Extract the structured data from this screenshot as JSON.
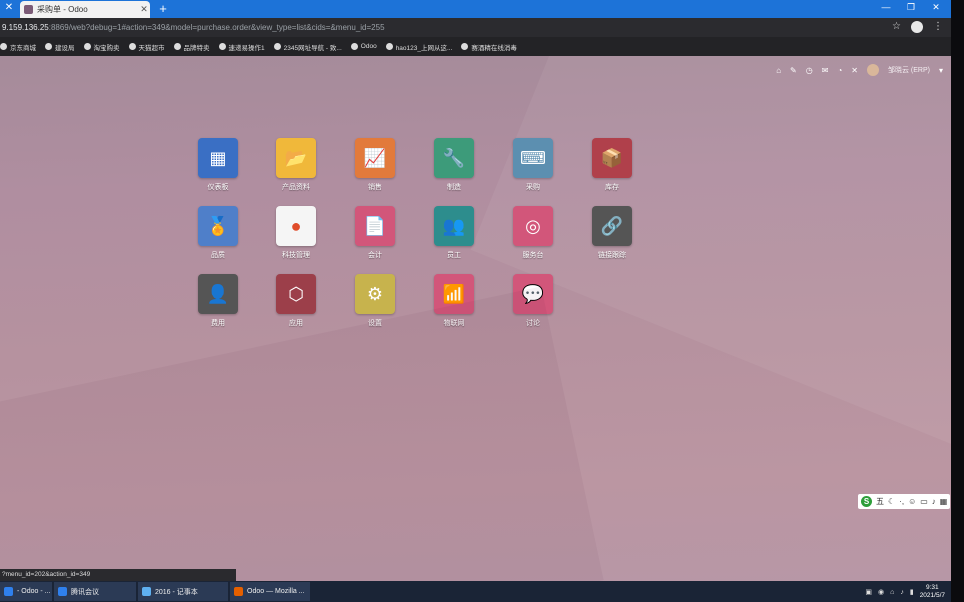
{
  "browser": {
    "tab_title": "采购单 - Odoo",
    "url_host": "9.159.136.25",
    "url_rest": ":8869/web?debug=1#action=349&model=purchase.order&view_type=list&cids=&menu_id=255",
    "bookmarks": [
      "京东商城",
      "建设局",
      "淘宝购卖",
      "天猫超市",
      "品牌特卖",
      "速递易操作1",
      "2345网址导航 - 致...",
      "Odoo",
      "hao123_上网从这...",
      "赛酒精在线消毒"
    ]
  },
  "odoo": {
    "user_name": "邹晓云 (ERP)",
    "apps": [
      {
        "label": "仪表板",
        "color": "#3a6fc4",
        "glyph": "▦"
      },
      {
        "label": "产品资料",
        "color": "#f0b83a",
        "glyph": "📂"
      },
      {
        "label": "销售",
        "color": "#e27a3b",
        "glyph": "📈"
      },
      {
        "label": "制造",
        "color": "#3d9b7a",
        "glyph": "🔧"
      },
      {
        "label": "采购",
        "color": "#5c8fb0",
        "glyph": "⌨"
      },
      {
        "label": "库存",
        "color": "#b0404b",
        "glyph": "📦"
      },
      {
        "label": "品质",
        "color": "#4f7fc9",
        "glyph": "🏅"
      },
      {
        "label": "科技管理",
        "color": "#f5f5f5",
        "glyph": "●"
      },
      {
        "label": "会计",
        "color": "#d2567a",
        "glyph": "📄"
      },
      {
        "label": "员工",
        "color": "#2d8d8d",
        "glyph": "👥"
      },
      {
        "label": "服务台",
        "color": "#d2567a",
        "glyph": "◎"
      },
      {
        "label": "链接跟踪",
        "color": "#555555",
        "glyph": "🔗"
      },
      {
        "label": "费用",
        "color": "#555555",
        "glyph": "👤"
      },
      {
        "label": "应用",
        "color": "#9c3f4a",
        "glyph": "⬡"
      },
      {
        "label": "设置",
        "color": "#c7b34d",
        "glyph": "⚙"
      },
      {
        "label": "物联网",
        "color": "#d2567a",
        "glyph": "📶"
      },
      {
        "label": "讨论",
        "color": "#d2567a",
        "glyph": "💬"
      }
    ]
  },
  "status_link": "?menu_id=202&action_id=349",
  "ime": {
    "mode": "五"
  },
  "taskbar": {
    "items": [
      {
        "label": "- Odoo - ...",
        "color": "#2f80ed"
      },
      {
        "label": "腾讯会议",
        "color": "#2f80ed"
      },
      {
        "label": "2016 - 记事本",
        "color": "#5fb0f0"
      },
      {
        "label": "Odoo — Mozilla ...",
        "color": "#e66000"
      }
    ],
    "time": "9:31",
    "date": "2021/5/7"
  }
}
